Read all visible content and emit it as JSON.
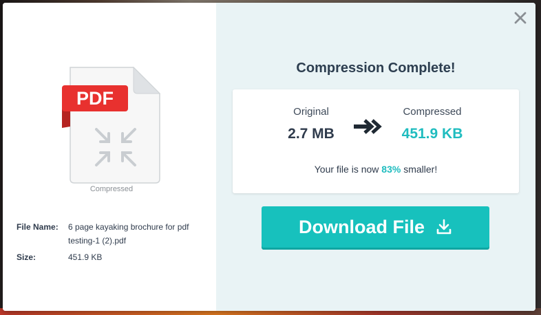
{
  "illustration": {
    "badge": "PDF",
    "caption": "Compressed"
  },
  "details": {
    "file_name_label": "File Name:",
    "file_name_value": "6 page kayaking brochure for pdf testing-1 (2).pdf",
    "size_label": "Size:",
    "size_value": "451.9 KB"
  },
  "result": {
    "title": "Compression Complete!",
    "original_label": "Original",
    "original_value": "2.7 MB",
    "compressed_label": "Compressed",
    "compressed_value": "451.9 KB",
    "summary_prefix": "Your file is now ",
    "summary_percent": "83%",
    "summary_suffix": " smaller!"
  },
  "actions": {
    "download_label": "Download File"
  },
  "icons": {
    "close": "close-icon",
    "arrow": "double-arrow-right-icon",
    "download": "download-icon",
    "compress": "compress-arrows-icon"
  },
  "colors": {
    "accent": "#17c1bd",
    "pdf_red": "#e8312f",
    "title": "#2d3e50",
    "right_pane": "#e9f3f5"
  }
}
